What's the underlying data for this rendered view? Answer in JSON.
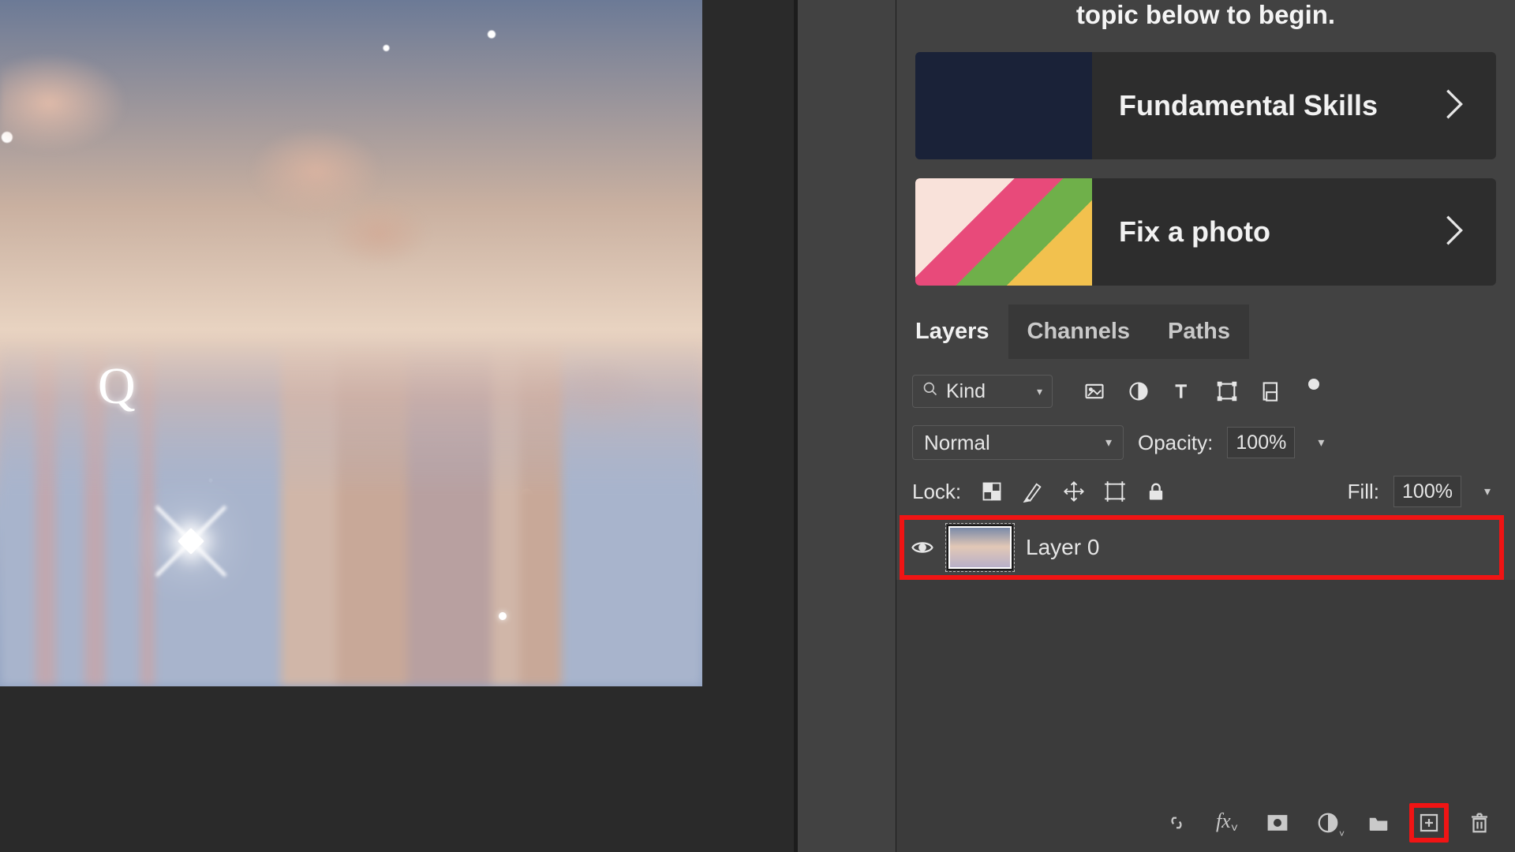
{
  "tutorial": {
    "header_fragment": "topic below to begin.",
    "cards": [
      {
        "label": "Fundamental Skills"
      },
      {
        "label": "Fix a photo"
      }
    ]
  },
  "tabs": {
    "layers": "Layers",
    "channels": "Channels",
    "paths": "Paths"
  },
  "filter": {
    "kind_label": "Kind"
  },
  "blend": {
    "mode": "Normal",
    "opacity_label": "Opacity:",
    "opacity_value": "100%"
  },
  "lock": {
    "label": "Lock:",
    "fill_label": "Fill:",
    "fill_value": "100%"
  },
  "layer0": {
    "name": "Layer 0"
  },
  "canvas": {
    "letter": "Q"
  }
}
